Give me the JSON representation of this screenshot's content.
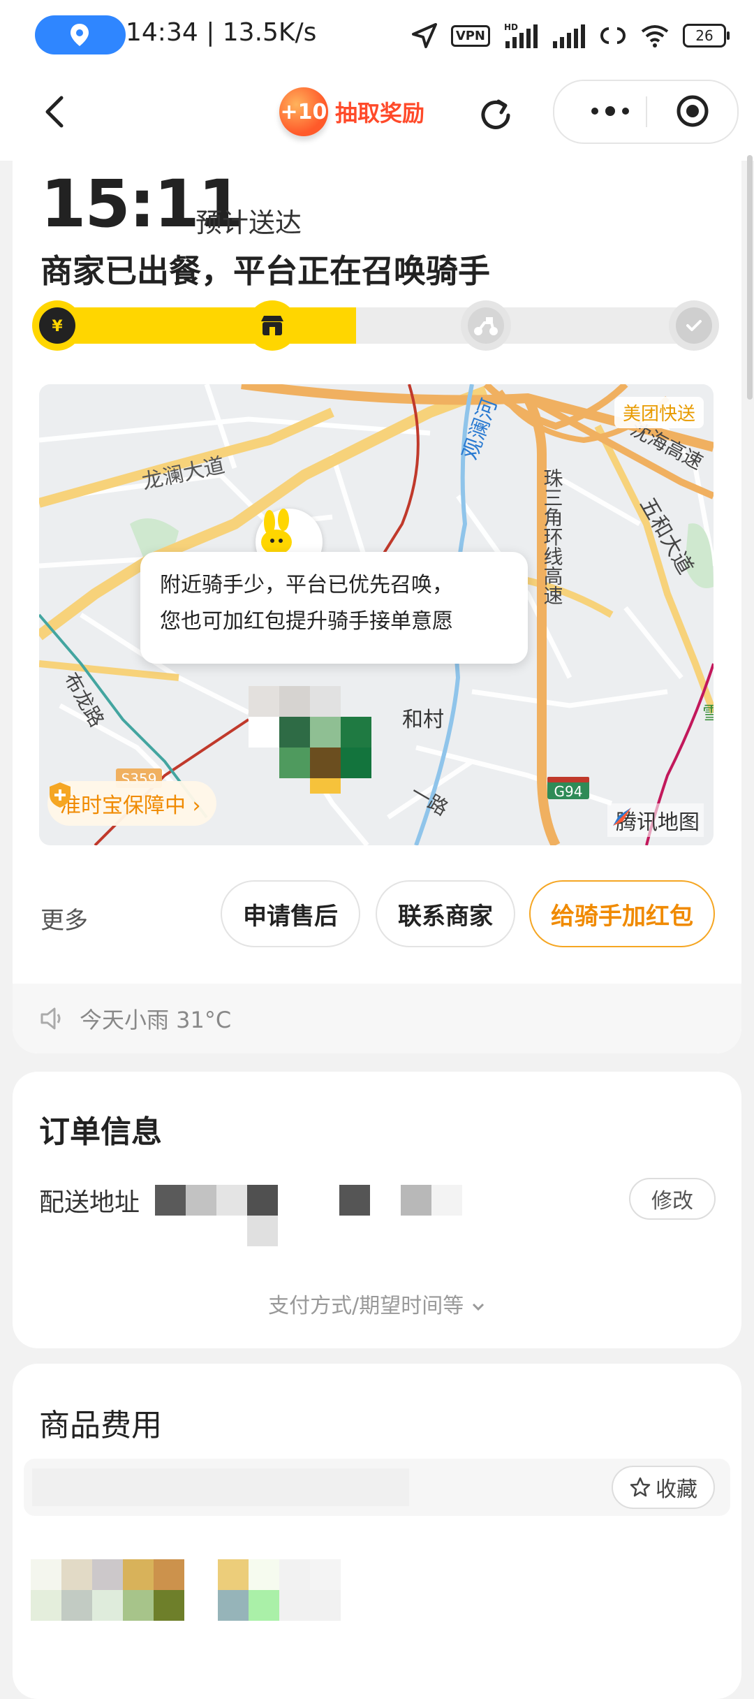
{
  "status_bar": {
    "time_speed": "14:34 | 13.5K/s",
    "vpn": "VPN",
    "hd": "HD",
    "battery": "26"
  },
  "nav": {
    "reward_badge": "+10",
    "reward_text": "抽取奖励"
  },
  "order": {
    "eta_time": "15:11",
    "eta_label": "预计送达",
    "status_title": "商家已出餐，平台正在召唤骑手",
    "progress_steps": 4,
    "progress_active_step": 2
  },
  "map": {
    "tip_line1": "附近骑手少，平台已优先召唤，",
    "tip_line2": "您也可加红包提升骑手接单意愿",
    "provider_tag": "美团快送",
    "guarantee": "准时宝保障中 ›",
    "tencent_label": "腾讯地图",
    "labels": {
      "road1": "龙澜大道",
      "road2": "沈海高速",
      "river": "观澜河",
      "expressway": "珠三角环线高速",
      "avenue": "五和大道",
      "road3": "布龙路",
      "village": "和村",
      "s359": "S359",
      "g94": "G94",
      "lu": "一路",
      "snow": "雪"
    }
  },
  "actions": {
    "more": "更多",
    "after_sale": "申请售后",
    "contact_merchant": "联系商家",
    "add_tip": "给骑手加红包"
  },
  "weather": {
    "text": "今天小雨 31°C"
  },
  "order_info": {
    "title": "订单信息",
    "address_label": "配送地址",
    "modify": "修改",
    "pay_more": "支付方式/期望时间等"
  },
  "goods": {
    "title": "商品费用",
    "favorite": "收藏"
  },
  "colors": {
    "accent_yellow": "#ffd600",
    "accent_orange": "#f08a00",
    "status_blue": "#2f86ff"
  }
}
